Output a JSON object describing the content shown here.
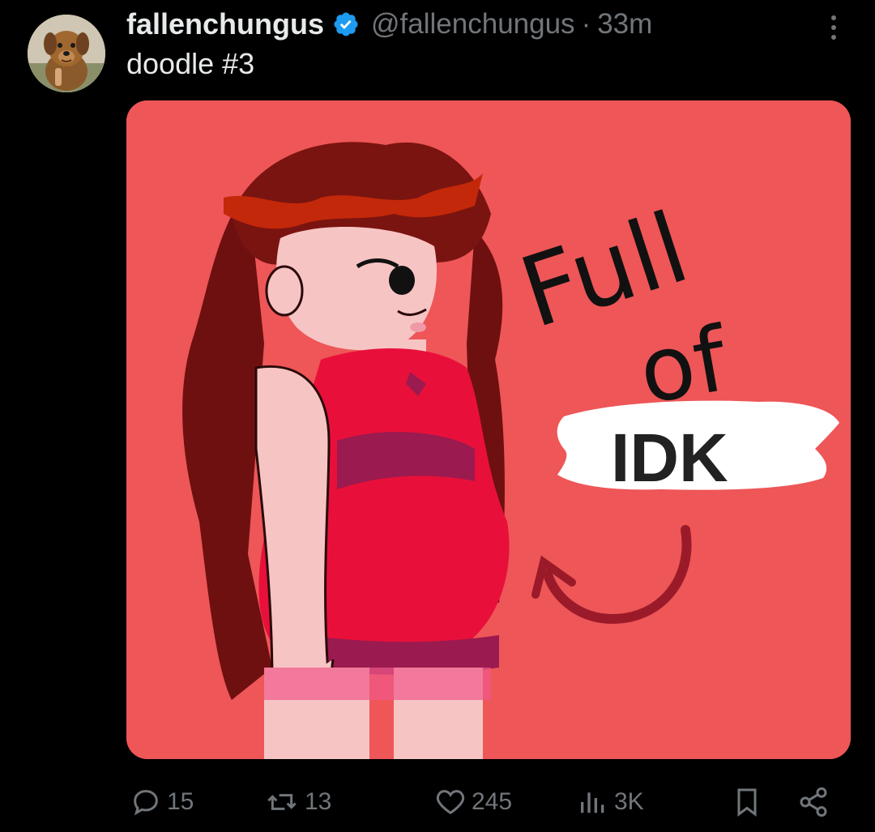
{
  "tweet": {
    "display_name": "fallenchungus",
    "handle": "@fallenchungus",
    "separator": "·",
    "time": "33m",
    "text": "doodle #3",
    "avatar_icon": "dog-avatar-icon",
    "verified_icon": "verified-badge-icon",
    "more_icon": "more-options-icon"
  },
  "media": {
    "image_text_1": "Full",
    "image_text_2": "of",
    "image_text_3": "IDK",
    "background_color": "#ee5657"
  },
  "actions": {
    "reply": {
      "icon": "reply-icon",
      "count": "15"
    },
    "retweet": {
      "icon": "retweet-icon",
      "count": "13"
    },
    "like": {
      "icon": "heart-icon",
      "count": "245"
    },
    "views": {
      "icon": "views-icon",
      "count": "3K"
    },
    "bookmark": {
      "icon": "bookmark-icon"
    },
    "share": {
      "icon": "share-icon"
    }
  },
  "colors": {
    "background": "#000000",
    "text_primary": "#e7e9ea",
    "text_secondary": "#71767b",
    "verified_blue": "#1d9bf0"
  }
}
